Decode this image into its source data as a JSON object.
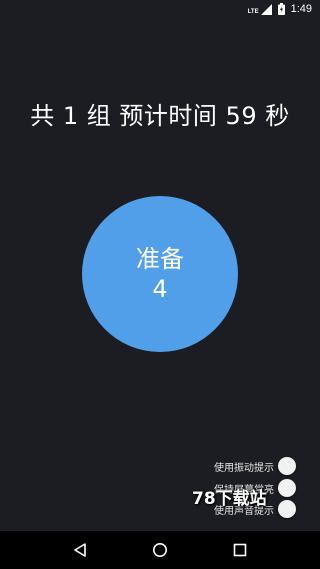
{
  "status_bar": {
    "network": "LTE",
    "time": "1:49",
    "icons": [
      "signal-icon",
      "battery-icon"
    ]
  },
  "summary": {
    "text": "共 1 组 预计时间 59 秒"
  },
  "countdown": {
    "phase": "准备",
    "value": "4",
    "color": "#519ee9"
  },
  "options": [
    {
      "label": "使用振动提示",
      "enabled": false
    },
    {
      "label": "保持屏幕常亮",
      "enabled": false
    },
    {
      "label": "使用声音提示",
      "enabled": false
    }
  ],
  "watermark": "78下载站",
  "nav_bar": {
    "buttons": [
      "back-icon",
      "home-icon",
      "recents-icon"
    ]
  },
  "colors": {
    "background": "#1b1d22",
    "accent": "#519ee9"
  }
}
